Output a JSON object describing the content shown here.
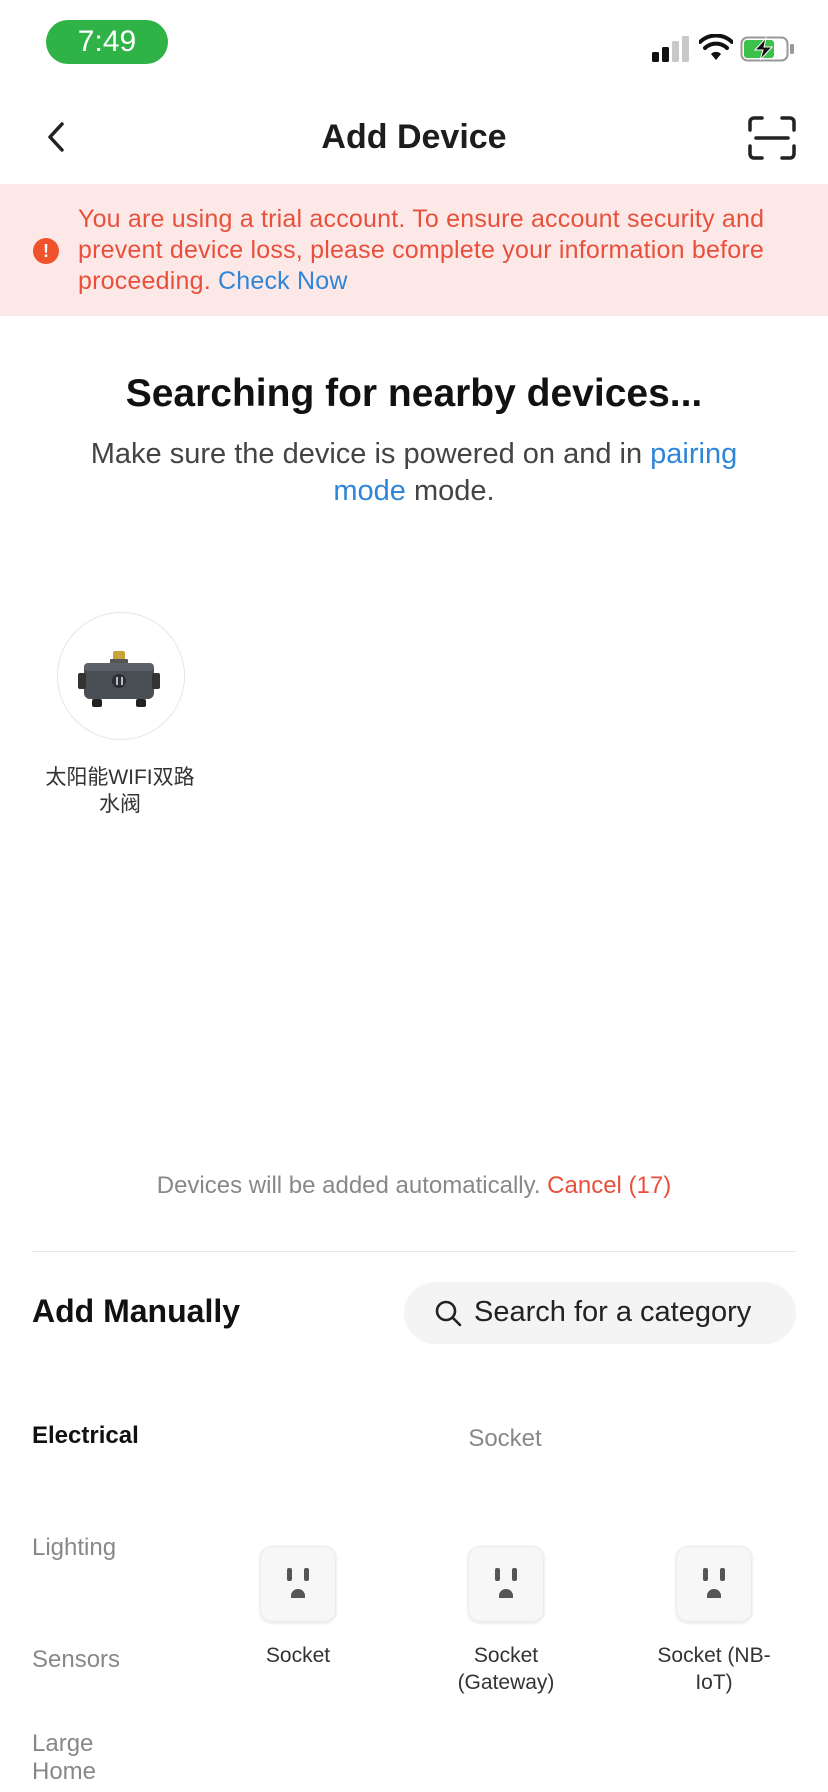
{
  "status_bar": {
    "time": "7:49"
  },
  "header": {
    "title": "Add Device"
  },
  "banner": {
    "message": "You are using a trial account. To ensure account security and prevent device loss, please complete your information before proceeding.",
    "link": "Check Now"
  },
  "search": {
    "title": "Searching for nearby devices...",
    "subtitle_before": "Make sure the device is powered on and in",
    "subtitle_link": "pairing mode",
    "subtitle_after": "mode."
  },
  "found_devices": [
    {
      "name": "太阳能WIFI双路水阀"
    }
  ],
  "auto_add": {
    "text": "Devices will be added automatically.",
    "cancel": "Cancel (17)"
  },
  "manual": {
    "title": "Add Manually",
    "search_placeholder": "Search for a category",
    "categories": [
      "Electrical",
      "Lighting",
      "Sensors",
      "Large Home"
    ],
    "active_category": "Electrical",
    "section_label": "Socket",
    "products": [
      {
        "name": "Socket"
      },
      {
        "name": "Socket (Gateway)"
      },
      {
        "name": "Socket (NB-IoT)"
      }
    ]
  },
  "colors": {
    "accent_green": "#2fb346",
    "link_blue": "#2f86d8",
    "warning_red": "#e8503c",
    "banner_bg": "#fde8e8"
  }
}
